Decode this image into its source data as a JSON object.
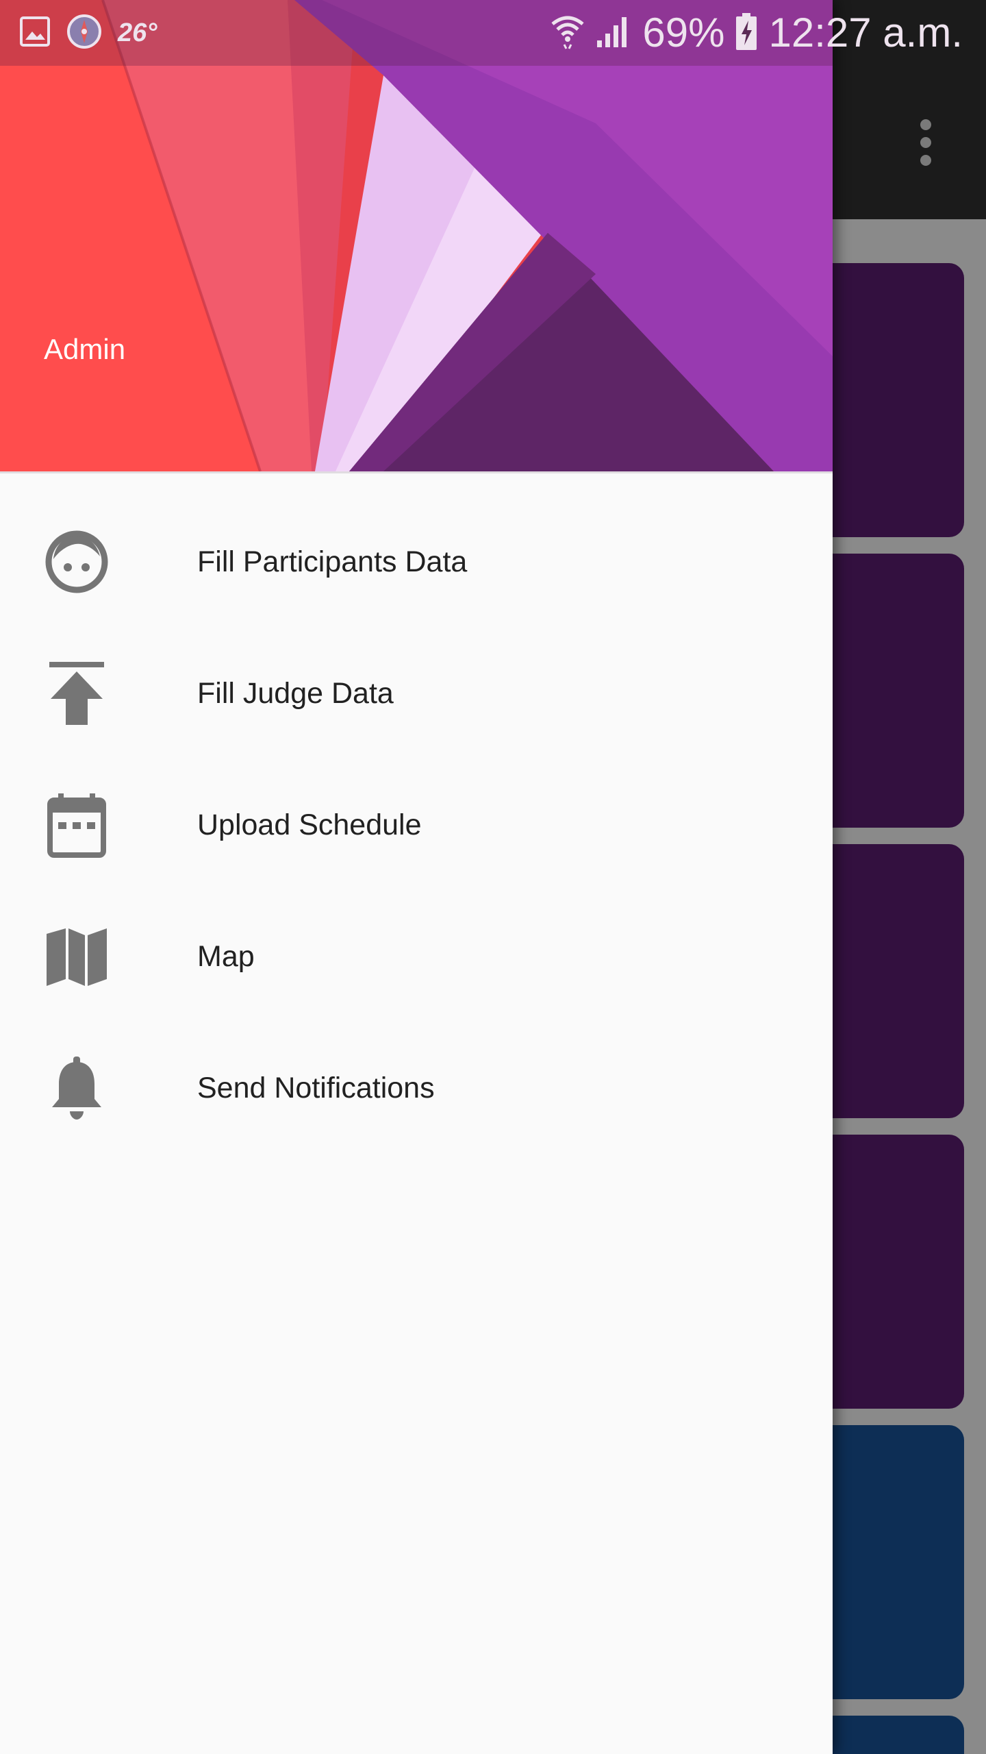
{
  "status_bar": {
    "temperature": "26°",
    "battery": "69%",
    "time": "12:27 a.m.",
    "icons": [
      "gallery-icon",
      "compass-icon",
      "wifi-icon",
      "signal-icon",
      "battery-charging-icon"
    ]
  },
  "drawer": {
    "header": {
      "user_name": "Admin"
    },
    "items": [
      {
        "label": "Fill Participants Data",
        "icon": "face-icon"
      },
      {
        "label": "Fill Judge Data",
        "icon": "upload-icon"
      },
      {
        "label": "Upload Schedule",
        "icon": "calendar-icon"
      },
      {
        "label": "Map",
        "icon": "map-icon"
      },
      {
        "label": "Send Notifications",
        "icon": "bell-icon"
      }
    ]
  },
  "colors": {
    "drawer_background": "#fafafa",
    "icon_gray": "#757575",
    "text_primary": "#212121",
    "card_purple": "#33103f",
    "card_blue": "#0d2e55"
  }
}
